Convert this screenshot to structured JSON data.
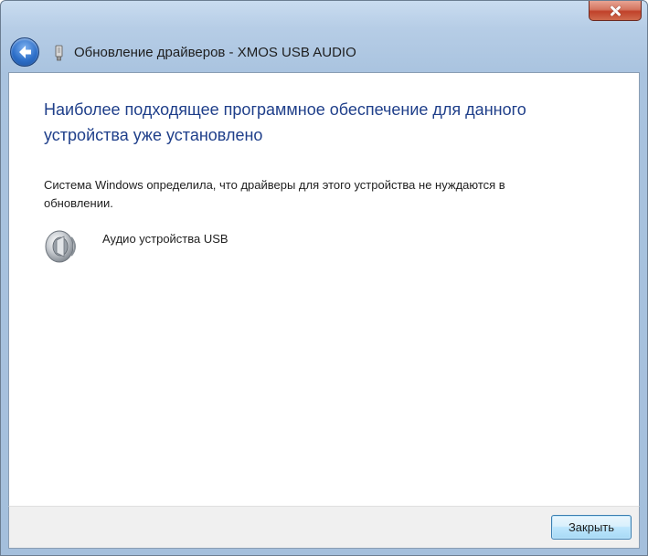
{
  "window": {
    "title": "Обновление драйверов - XMOS USB AUDIO",
    "close_icon": "close-icon",
    "back_icon": "back-arrow-icon"
  },
  "main": {
    "heading": "Наиболее подходящее программное обеспечение для данного устройства уже установлено",
    "description": "Система Windows определила, что драйверы для этого устройства не нуждаются в обновлении.",
    "device": {
      "icon": "speaker-icon",
      "label": "Аудио устройства USB"
    }
  },
  "footer": {
    "close_button_label": "Закрыть"
  },
  "colors": {
    "heading": "#1f3f8a",
    "frame": "#a9c3df",
    "close_button": "#c0412a",
    "back_button": "#2d6fc9"
  }
}
